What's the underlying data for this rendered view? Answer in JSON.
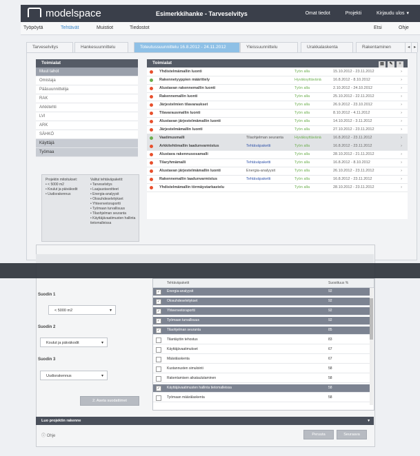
{
  "brand": {
    "logo_text": "modelspace",
    "project_title": "Esimerkkihanke - Tarveselvitys"
  },
  "top_nav": [
    "Omat tiedot",
    "Projekti",
    "Kirjaudu ulos"
  ],
  "menu_left": [
    "Työpöytä",
    "Tehtävät",
    "Muistiot",
    "Tiedostot"
  ],
  "menu_right": [
    "Etsi",
    "Ohje"
  ],
  "phase_tabs": [
    "Tarveselvitys",
    "Hankesuunnittelu",
    "Toteutussuunnittelu 16.8.2012 - 24.11.2012",
    "Yleissuunnittelu",
    "Urakkalaskenta",
    "Rakentaminen"
  ],
  "left_panel": {
    "title": "Toimialat",
    "items": [
      "Muut tahot",
      "Omistaja",
      "Pääsuunnittelija",
      "RAK",
      "Arkkitehti",
      "LVI",
      "ARK",
      "SÄHKÖ",
      "Käyttäjä",
      "Työmaa"
    ],
    "filter_left": [
      "Projektin mitoitukset:",
      "• < 5000 m2",
      "• Koulut ja päiväkodit",
      "• Uudisrakennus"
    ],
    "filter_right": [
      "Valitut tehtäväpaketit:",
      "• Tarveselvitys",
      "• Laajuustavoitteet",
      "• Energia-analyysit",
      "• Olosuhdeselvitykset",
      "• Yhteenvetoraportti",
      "• Työmaan turvallisuus",
      "• Tilaohjelman seuranta",
      "• Käyttäjävaatimusten hallinta tietomalleissa"
    ]
  },
  "right_panel": {
    "title": "Toimialat",
    "icons": [
      "print-icon",
      "edit-icon",
      "add-icon"
    ],
    "tasks": [
      {
        "name": "Yhdistelmämallin luonti",
        "type": "",
        "status": "Työn alla",
        "date": "15.10.2012 - 23.11.2012",
        "dot": "#e8502d",
        "link": false
      },
      {
        "name": "Rakennetyyppien määrittely",
        "type": "",
        "status": "Hyväksyttävänä",
        "date": "16.8.2012 - 8.10.2012",
        "dot": "#6cae4f",
        "link": false
      },
      {
        "name": "Alustavan rakennemallin luonti",
        "type": "",
        "status": "Työn alla",
        "date": "2.10.2012 - 24.10.2012",
        "dot": "#e8502d",
        "link": false
      },
      {
        "name": "Rakennemallin luonti",
        "type": "",
        "status": "Työn alla",
        "date": "25.10.2012 - 22.11.2012",
        "dot": "#e8502d",
        "link": false
      },
      {
        "name": "Järjestelmien tilavaraukset",
        "type": "",
        "status": "Työn alla",
        "date": "26.9.2012 - 23.10.2012",
        "dot": "#e8502d",
        "link": false
      },
      {
        "name": "Tilavarausmallin luonti",
        "type": "",
        "status": "Työn alla",
        "date": "8.10.2012 - 4.11.2012",
        "dot": "#e8502d",
        "link": false
      },
      {
        "name": "Alustavan järjestelmämallin luonti",
        "type": "",
        "status": "Työn alla",
        "date": "14.10.2012 - 3.11.2012",
        "dot": "#e8502d",
        "link": false
      },
      {
        "name": "Järjestelmämallin luonti",
        "type": "",
        "status": "Työn alla",
        "date": "27.10.2012 - 23.11.2012",
        "dot": "#e8502d",
        "link": false
      },
      {
        "name": "Vaatimusmalli",
        "type": "Tilaohjelman seuranta",
        "status": "Hyväksyttävänä",
        "date": "16.8.2012 - 23.11.2012",
        "dot": "#6cae4f",
        "link": false
      },
      {
        "name": "Arkkitehtimallin laadunvarmistus",
        "type": "Tehtäväpaketti",
        "status": "Työn alla",
        "date": "16.8.2012 - 23.11.2012",
        "dot": "#e8502d",
        "link": true
      },
      {
        "name": "Alustava rakennusosamalli",
        "type": "",
        "status": "Työn alla",
        "date": "28.10.2012 - 21.11.2012",
        "dot": "#e8502d",
        "link": false
      },
      {
        "name": "Tilaryhmämalli",
        "type": "Tehtäväpaketti",
        "status": "Työn alla",
        "date": "16.8.2012 - 8.10.2012",
        "dot": "#e8502d",
        "link": true
      },
      {
        "name": "Alustavan järjestelmämallin luonti",
        "type": "Energia-analyysit",
        "status": "Työn alla",
        "date": "26.10.2012 - 23.11.2012",
        "dot": "#e8502d",
        "link": false
      },
      {
        "name": "Rakennemallin laadunvarmistus",
        "type": "Tehtäväpaketti",
        "status": "Työn alla",
        "date": "16.8.2012 - 23.11.2012",
        "dot": "#e8502d",
        "link": true
      },
      {
        "name": "Yhdistelmämallin törmäystarkastelu",
        "type": "",
        "status": "Työn alla",
        "date": "28.10.2012 - 23.11.2012",
        "dot": "#e8502d",
        "link": false
      }
    ]
  },
  "modal": {
    "filter1_label": "Suodin 1",
    "filter1_value": "< 5000 m2",
    "filter2_label": "Suodin 2",
    "filter2_value": "Koulut ja päiväkodit",
    "filter3_label": "Suodin 3",
    "filter3_value": "Uudisrakennus",
    "apply_button": "2. Aseta suodattimet",
    "list_header_name": "Tehtäväpaketit",
    "list_header_pct": "Suosittuus %",
    "packages": [
      {
        "name": "Energia-analyysit",
        "pct": "92",
        "checked": true
      },
      {
        "name": "Olosuhdeselvitykset",
        "pct": "92",
        "checked": true
      },
      {
        "name": "Yhteenvetoraportti",
        "pct": "92",
        "checked": true
      },
      {
        "name": "Työmaan turvallisuus",
        "pct": "92",
        "checked": true
      },
      {
        "name": "Tilaohjelman seuranta",
        "pct": "85",
        "checked": true
      },
      {
        "name": "Tilantäytön tehostus",
        "pct": "83",
        "checked": false
      },
      {
        "name": "Käyttäjävaatimukset",
        "pct": "67",
        "checked": false
      },
      {
        "name": "Määrälaskenta",
        "pct": "67",
        "checked": false
      },
      {
        "name": "Kustannusten simulointi",
        "pct": "58",
        "checked": false
      },
      {
        "name": "Rakentamisen aikataulutaminen",
        "pct": "58",
        "checked": false
      },
      {
        "name": "Käyttäjävaatimusten hallinta tietomalleissa",
        "pct": "58",
        "checked": true
      },
      {
        "name": "Työmaan määrälaskenta",
        "pct": "58",
        "checked": false
      }
    ],
    "create_bar_label": "Luo projektin rakenne",
    "help_label": "Ohje",
    "back_button": "Peruuta",
    "next_button": "Seuraava"
  }
}
